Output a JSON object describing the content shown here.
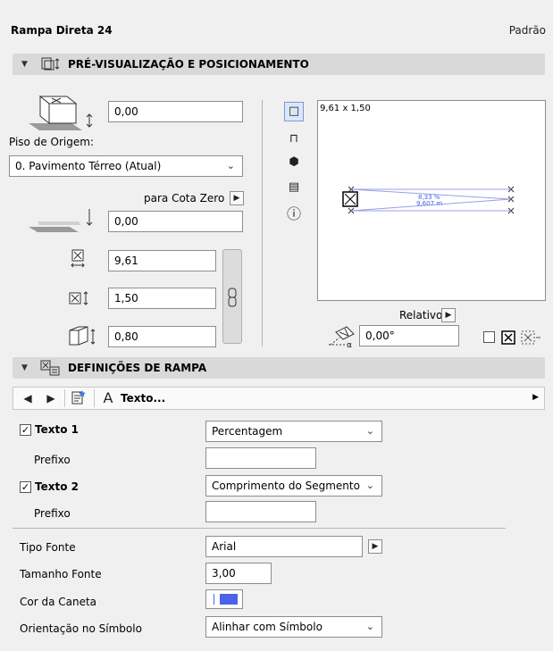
{
  "header": {
    "title": "Rampa Direta 24",
    "standard": "Padrão"
  },
  "preview_section": {
    "title": "PRÉ-VISUALIZAÇÃO E POSICIONAMENTO",
    "offset_value": "0,00",
    "origin_floor_label": "Piso de Origem:",
    "origin_floor_value": "0. Pavimento Térreo (Atual)",
    "to_zero_label": "para Cota Zero",
    "zero_value": "0,00",
    "length_value": "9,61",
    "width_value": "1,50",
    "height_value": "0,80",
    "preview_dimensions": "9,61 x 1,50",
    "preview_text_percent": "8,33 %",
    "preview_text_length": "9,607 m",
    "relative_label": "Relativo",
    "angle_value": "0,00°"
  },
  "ramp_section": {
    "title": "DEFINIÇÕES DE RAMPA",
    "toolbar_label": "Texto..."
  },
  "text_settings": {
    "text1_label": "Texto 1",
    "text1_value": "Percentagem",
    "text1_checked": true,
    "prefix1_label": "Prefixo",
    "prefix1_value": "",
    "text2_label": "Texto 2",
    "text2_value": "Comprimento do Segmento",
    "text2_checked": true,
    "prefix2_label": "Prefixo",
    "prefix2_value": "",
    "font_type_label": "Tipo Fonte",
    "font_type_value": "Arial",
    "font_size_label": "Tamanho Fonte",
    "font_size_value": "3,00",
    "pen_color_label": "Cor da Caneta",
    "pen_color": "#4a63e8",
    "orientation_label": "Orientação no Símbolo",
    "orientation_value": "Alinhar com Símbolo"
  },
  "icons": [
    "triangle-down-icon",
    "floorplan-preview-icon",
    "ramp-box-icon",
    "gear-box-icon",
    "info-icon",
    "link-chain-icon",
    "angle-icon",
    "prev-icon",
    "next-icon",
    "favorite-icon",
    "text-icon"
  ]
}
